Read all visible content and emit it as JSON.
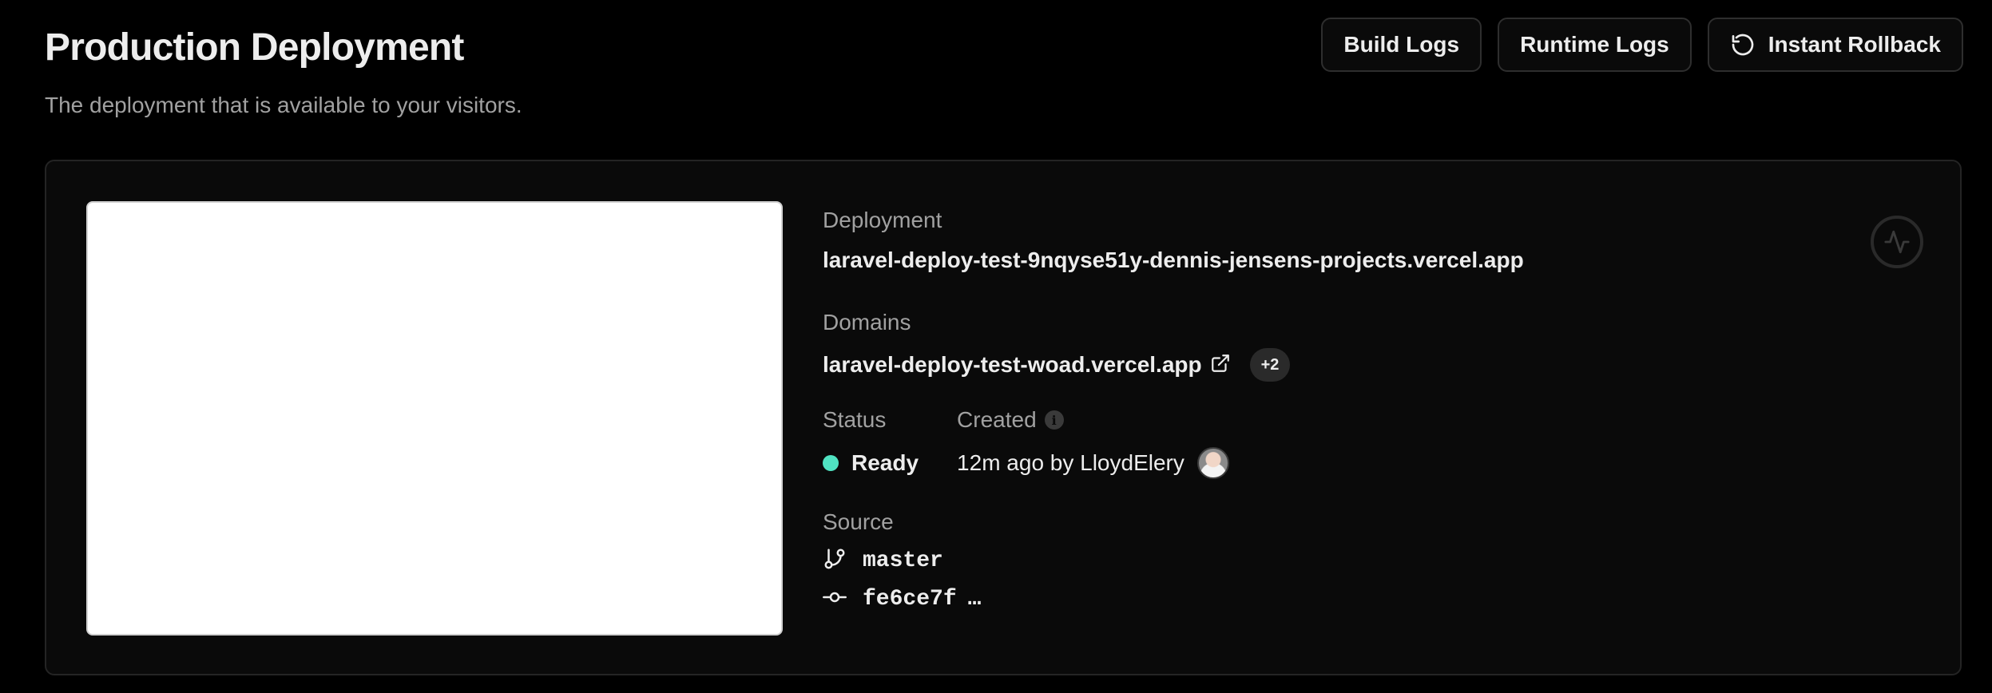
{
  "header": {
    "title": "Production Deployment",
    "subtitle": "The deployment that is available to your visitors."
  },
  "actions": {
    "build_logs": "Build Logs",
    "runtime_logs": "Runtime Logs",
    "instant_rollback": "Instant Rollback"
  },
  "deployment": {
    "label": "Deployment",
    "url": "laravel-deploy-test-9nqyse51y-dennis-jensens-projects.vercel.app"
  },
  "domains": {
    "label": "Domains",
    "primary": "laravel-deploy-test-woad.vercel.app",
    "extra_count": "+2"
  },
  "status": {
    "label": "Status",
    "value": "Ready",
    "color": "#50e3c2"
  },
  "created": {
    "label": "Created",
    "info_glyph": "i",
    "value": "12m ago by LloydElery"
  },
  "source": {
    "label": "Source",
    "branch": "master",
    "commit": "fe6ce7f",
    "commit_ellipsis": "…"
  },
  "icons": {
    "rollback": "rotate-ccw-icon",
    "external_link": "external-link-icon",
    "branch": "git-branch-icon",
    "commit": "git-commit-icon",
    "activity": "activity-icon",
    "info": "info-icon"
  },
  "colors": {
    "background": "#000000",
    "card": "#0a0a0a",
    "text": "#ededed",
    "muted": "#a1a1a1",
    "ready": "#50e3c2"
  }
}
